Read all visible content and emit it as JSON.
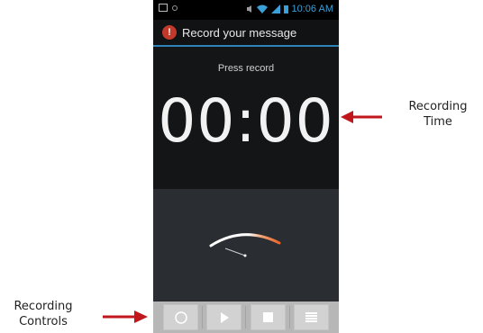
{
  "status_bar": {
    "time": "10:06 AM"
  },
  "action_bar": {
    "title": "Record your message",
    "icon": "alert-icon"
  },
  "recorder": {
    "status": "Press record",
    "elapsed_time": "00:00"
  },
  "controls": [
    {
      "name": "record-button",
      "icon": "record-icon"
    },
    {
      "name": "play-button",
      "icon": "play-icon"
    },
    {
      "name": "stop-button",
      "icon": "stop-icon"
    },
    {
      "name": "list-button",
      "icon": "list-icon"
    }
  ],
  "annotations": {
    "recording_time": [
      "Recording",
      "Time"
    ],
    "recording_controls": [
      "Recording",
      "Controls"
    ]
  },
  "colors": {
    "accent": "#2e84b8",
    "arrow": "#c0161c",
    "gauge_orange": "#e8632b"
  }
}
